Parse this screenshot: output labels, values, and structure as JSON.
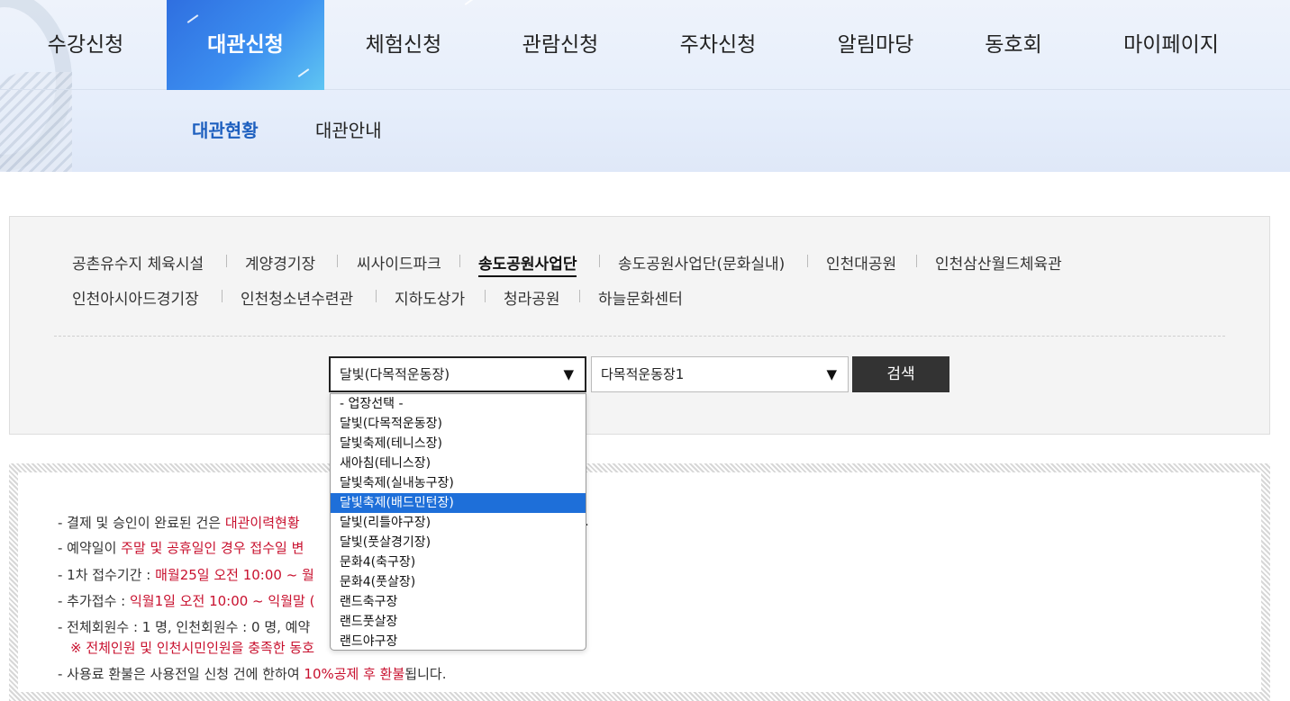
{
  "gnb": [
    {
      "label": "수강신청",
      "active": false
    },
    {
      "label": "대관신청",
      "active": true
    },
    {
      "label": "체험신청",
      "active": false
    },
    {
      "label": "관람신청",
      "active": false
    },
    {
      "label": "주차신청",
      "active": false
    },
    {
      "label": "알림마당",
      "active": false
    },
    {
      "label": "동호회",
      "active": false
    },
    {
      "label": "마이페이지",
      "active": false
    }
  ],
  "lnb": [
    {
      "label": "대관현황",
      "active": true
    },
    {
      "label": "대관안내",
      "active": false
    }
  ],
  "facilities": [
    {
      "label": "공촌유수지 체육시설",
      "active": false
    },
    {
      "label": "계양경기장",
      "active": false
    },
    {
      "label": "씨사이드파크",
      "active": false
    },
    {
      "label": "송도공원사업단",
      "active": true
    },
    {
      "label": "송도공원사업단(문화실내)",
      "active": false
    },
    {
      "label": "인천대공원",
      "active": false
    },
    {
      "label": "인천삼산월드체육관",
      "active": false
    },
    {
      "label": "인천아시아드경기장",
      "active": false
    },
    {
      "label": "인천청소년수련관",
      "active": false
    },
    {
      "label": "지하도상가",
      "active": false
    },
    {
      "label": "청라공원",
      "active": false
    },
    {
      "label": "하늘문화센터",
      "active": false
    }
  ],
  "search": {
    "venue_selected": "달빛(다목적운동장)",
    "court_selected": "다목적운동장1",
    "button_label": "검색",
    "arrow_glyph": "▼"
  },
  "dropdown_options": [
    "- 업장선택 -",
    "달빛(다목적운동장)",
    "달빛축제(테니스장)",
    "새아침(테니스장)",
    "달빛축제(실내농구장)",
    "달빛축제(배드민턴장)",
    "달빛(리틀야구장)",
    "달빛(풋살경기장)",
    "문화4(축구장)",
    "문화4(풋살장)",
    "랜드축구장",
    "랜드풋살장",
    "랜드야구장"
  ],
  "dropdown_highlight_index": 5,
  "notice": {
    "l1_a": "- 결제 및 승인이 완료된 건은 ",
    "l1_b": "대관이력현황",
    "l1_c": ".",
    "l2_a": "- 예약일이 ",
    "l2_b": "주말 및 공휴일인 경우 접수일 변",
    "l3_a": "- 1차 접수기간 : ",
    "l3_b": "매월25일 오전 10:00 ~ 월",
    "l4_a": "- 추가접수 : ",
    "l4_b": "익월1일 오전 10:00 ~ 익월말 (",
    "l5": "- 전체회원수 : 1 명, 인천회원수 : 0 명, 예약",
    "l6": "※ 전체인원 및 인천시민인원을 충족한 동호",
    "l7_a": "- 사용료 환불은 사용전일 신청 건에 한하여 ",
    "l7_b": "10%공제 후 환불",
    "l7_c": "됩니다."
  },
  "colors": {
    "accent": "#2f6fe0",
    "lnb_active": "#1d5fbf",
    "notice_red": "#c8102e",
    "highlight": "#1e6fd9"
  }
}
